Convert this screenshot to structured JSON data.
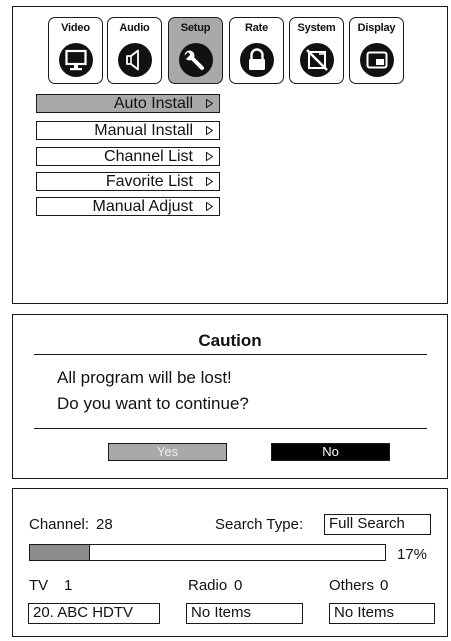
{
  "tabs": [
    {
      "label": "Video",
      "icon": "monitor-icon",
      "active": false
    },
    {
      "label": "Audio",
      "icon": "speaker-icon",
      "active": false
    },
    {
      "label": "Setup",
      "icon": "wrench-icon",
      "active": true
    },
    {
      "label": "Rate",
      "icon": "lock-icon",
      "active": false
    },
    {
      "label": "System",
      "icon": "system-icon",
      "active": false
    },
    {
      "label": "Display",
      "icon": "display-icon",
      "active": false
    }
  ],
  "setup_menu": {
    "items": [
      {
        "label": "Auto Install",
        "selected": true
      },
      {
        "label": "Manual Install",
        "selected": false
      },
      {
        "label": "Channel List",
        "selected": false
      },
      {
        "label": "Favorite List",
        "selected": false
      },
      {
        "label": "Manual Adjust",
        "selected": false
      }
    ]
  },
  "caution": {
    "title": "Caution",
    "line1": "All program will be lost!",
    "line2": "Do you want to continue?",
    "yes_label": "Yes",
    "no_label": "No"
  },
  "search": {
    "channel_label": "Channel:",
    "channel_value": "28",
    "search_type_label": "Search Type:",
    "search_type_value": "Full Search",
    "progress_percent": 17,
    "progress_text": "17%",
    "tv_label": "TV",
    "tv_count": "1",
    "radio_label": "Radio",
    "radio_count": "0",
    "others_label": "Others",
    "others_count": "0",
    "tv_item": "20. ABC HDTV",
    "radio_item": "No Items",
    "others_item": "No Items"
  },
  "colors": {
    "selected_gray": "#a9a9a9",
    "progress_fill": "#8d8d8d",
    "no_button": "#000000"
  }
}
